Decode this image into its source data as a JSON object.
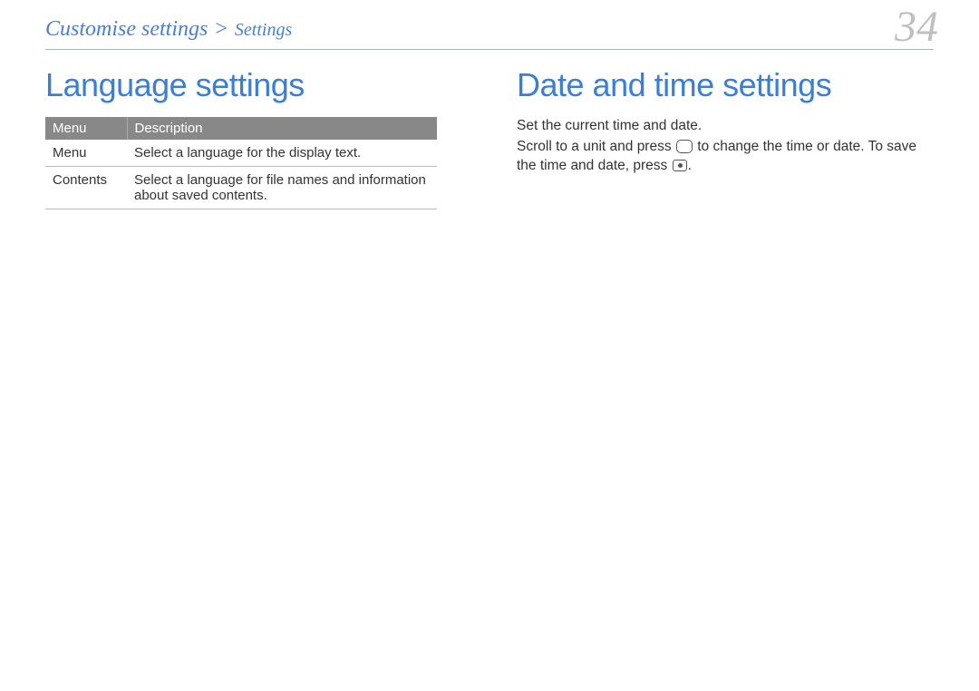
{
  "header": {
    "breadcrumb_main": "Customise settings",
    "breadcrumb_sep": ">",
    "breadcrumb_sub": "Settings",
    "page_number": "34"
  },
  "left": {
    "title": "Language settings",
    "table": {
      "headers": [
        "Menu",
        "Description"
      ],
      "rows": [
        {
          "menu": "Menu",
          "desc": "Select a language for the display text."
        },
        {
          "menu": "Contents",
          "desc": "Select a language for file names and information about saved contents."
        }
      ]
    }
  },
  "right": {
    "title": "Date and time settings",
    "para1": "Set the current time and date.",
    "para2_a": "Scroll to a unit and press ",
    "para2_b": " to change the time or date. To save the time and date, press ",
    "para2_c": "."
  }
}
